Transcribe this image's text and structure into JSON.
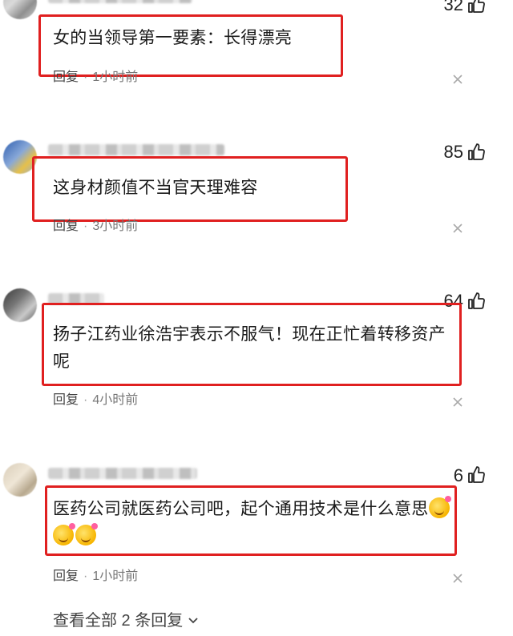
{
  "comments": [
    {
      "likes": "32",
      "text": "女的当领导第一要素：长得漂亮",
      "reply_label": "回复",
      "separator": "·",
      "time": "1小时前"
    },
    {
      "likes": "85",
      "text": "这身材颜值不当官天理难容",
      "reply_label": "回复",
      "separator": "·",
      "time": "3小时前"
    },
    {
      "likes": "64",
      "text_line1": "扬子江药业徐浩宇表示不服气！现在正忙着转移资产",
      "text_line2": "呢",
      "reply_label": "回复",
      "separator": "·",
      "time": "4小时前"
    },
    {
      "likes": "6",
      "text": "医药公司就医药公司吧，起个通用技术是什么意思",
      "reply_label": "回复",
      "separator": "·",
      "time": "1小时前"
    }
  ],
  "view_replies": "查看全部 2 条回复",
  "icons": {
    "like": "thumbs-up-outline-icon",
    "close": "close-x-icon",
    "expand": "chevron-down-icon",
    "emoji": "kiss-face-emoji"
  },
  "colors": {
    "highlight_border": "#e02020",
    "text": "#1a1a1a",
    "meta": "#666666"
  }
}
